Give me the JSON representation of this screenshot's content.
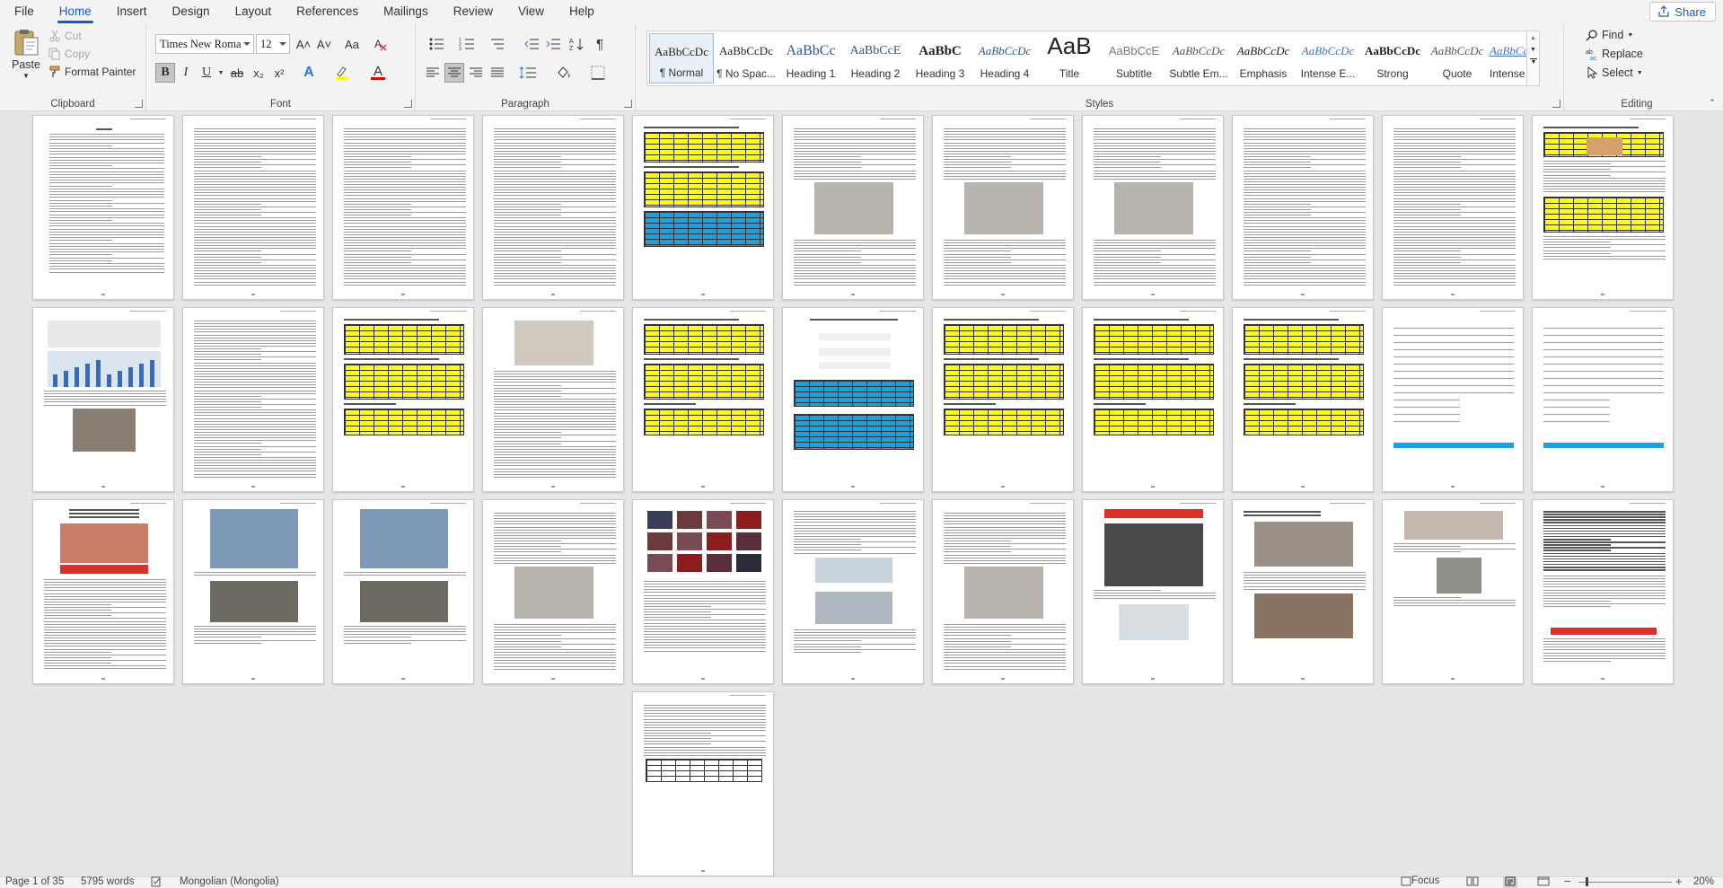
{
  "menu": {
    "tabs": [
      "File",
      "Home",
      "Insert",
      "Design",
      "Layout",
      "References",
      "Mailings",
      "Review",
      "View",
      "Help"
    ],
    "active": "Home",
    "share_label": "Share"
  },
  "clipboard": {
    "paste_label": "Paste",
    "cut_label": "Cut",
    "copy_label": "Copy",
    "format_painter_label": "Format Painter",
    "group_label": "Clipboard"
  },
  "font": {
    "font_name": "Times New Roma",
    "font_size": "12",
    "group_label": "Font",
    "bold": "B",
    "italic": "I",
    "underline": "U",
    "strike": "ab",
    "subscript": "x₂",
    "superscript": "x²",
    "grow": "A˄",
    "shrink": "A˅",
    "change_case": "Aa",
    "effects": "A",
    "highlight": "ab",
    "color": "A"
  },
  "paragraph": {
    "group_label": "Paragraph",
    "pilcrow": "¶"
  },
  "styles": {
    "group_label": "Styles",
    "items": [
      {
        "sample": "AaBbCcDc",
        "name": "¶ Normal"
      },
      {
        "sample": "AaBbCcDc",
        "name": "¶ No Spac..."
      },
      {
        "sample": "AaBbCc",
        "name": "Heading 1"
      },
      {
        "sample": "AaBbCcE",
        "name": "Heading 2"
      },
      {
        "sample": "AaBbC",
        "name": "Heading 3"
      },
      {
        "sample": "AaBbCcDc",
        "name": "Heading 4"
      },
      {
        "sample": "AaB",
        "name": "Title"
      },
      {
        "sample": "AaBbCcE",
        "name": "Subtitle"
      },
      {
        "sample": "AaBbCcDc",
        "name": "Subtle Em..."
      },
      {
        "sample": "AaBbCcDc",
        "name": "Emphasis"
      },
      {
        "sample": "AaBbCcDc",
        "name": "Intense E..."
      },
      {
        "sample": "AaBbCcDc",
        "name": "Strong"
      },
      {
        "sample": "AaBbCcDc",
        "name": "Quote"
      },
      {
        "sample": "AaBbCcDc",
        "name": "Intense Q..."
      }
    ]
  },
  "editing": {
    "group_label": "Editing",
    "find_label": "Find",
    "replace_label": "Replace",
    "select_label": "Select"
  },
  "status": {
    "page": "Page 1 of 35",
    "words": "5795 words",
    "language": "Mongolian (Mongolia)",
    "focus": "Focus",
    "zoom": "20%"
  },
  "colors": {
    "accent": "#185abd",
    "highlight_yellow": "#ffff00",
    "font_red": "#e00000",
    "table_yellow": "#ffff00",
    "table_blue": "#1ba1e2",
    "banner_red": "#d9302c"
  },
  "icons": [
    "paste-icon",
    "cut-icon",
    "copy-icon",
    "format-painter-icon",
    "bullets-icon",
    "numbering-icon",
    "multilevel-icon",
    "decrease-indent-icon",
    "increase-indent-icon",
    "sort-icon",
    "align-left-icon",
    "align-center-icon",
    "align-right-icon",
    "justify-icon",
    "line-spacing-icon",
    "shading-icon",
    "borders-icon",
    "find-icon",
    "replace-icon",
    "select-icon",
    "proofing-icon",
    "print-layout-icon",
    "read-mode-icon",
    "web-layout-icon"
  ]
}
